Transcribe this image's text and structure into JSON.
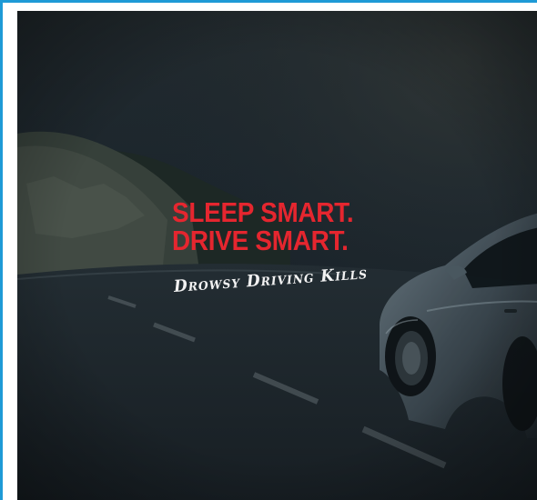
{
  "ad": {
    "headline_line1": "SLEEP SMART.",
    "headline_line2": "DRIVE SMART.",
    "tagline": "Drowsy Driving Kills"
  },
  "colors": {
    "frame_accent": "#1e9ad6",
    "headline_red": "#e5262f",
    "tagline_white": "#f2f2f2",
    "night_sky": "#1b242b"
  }
}
